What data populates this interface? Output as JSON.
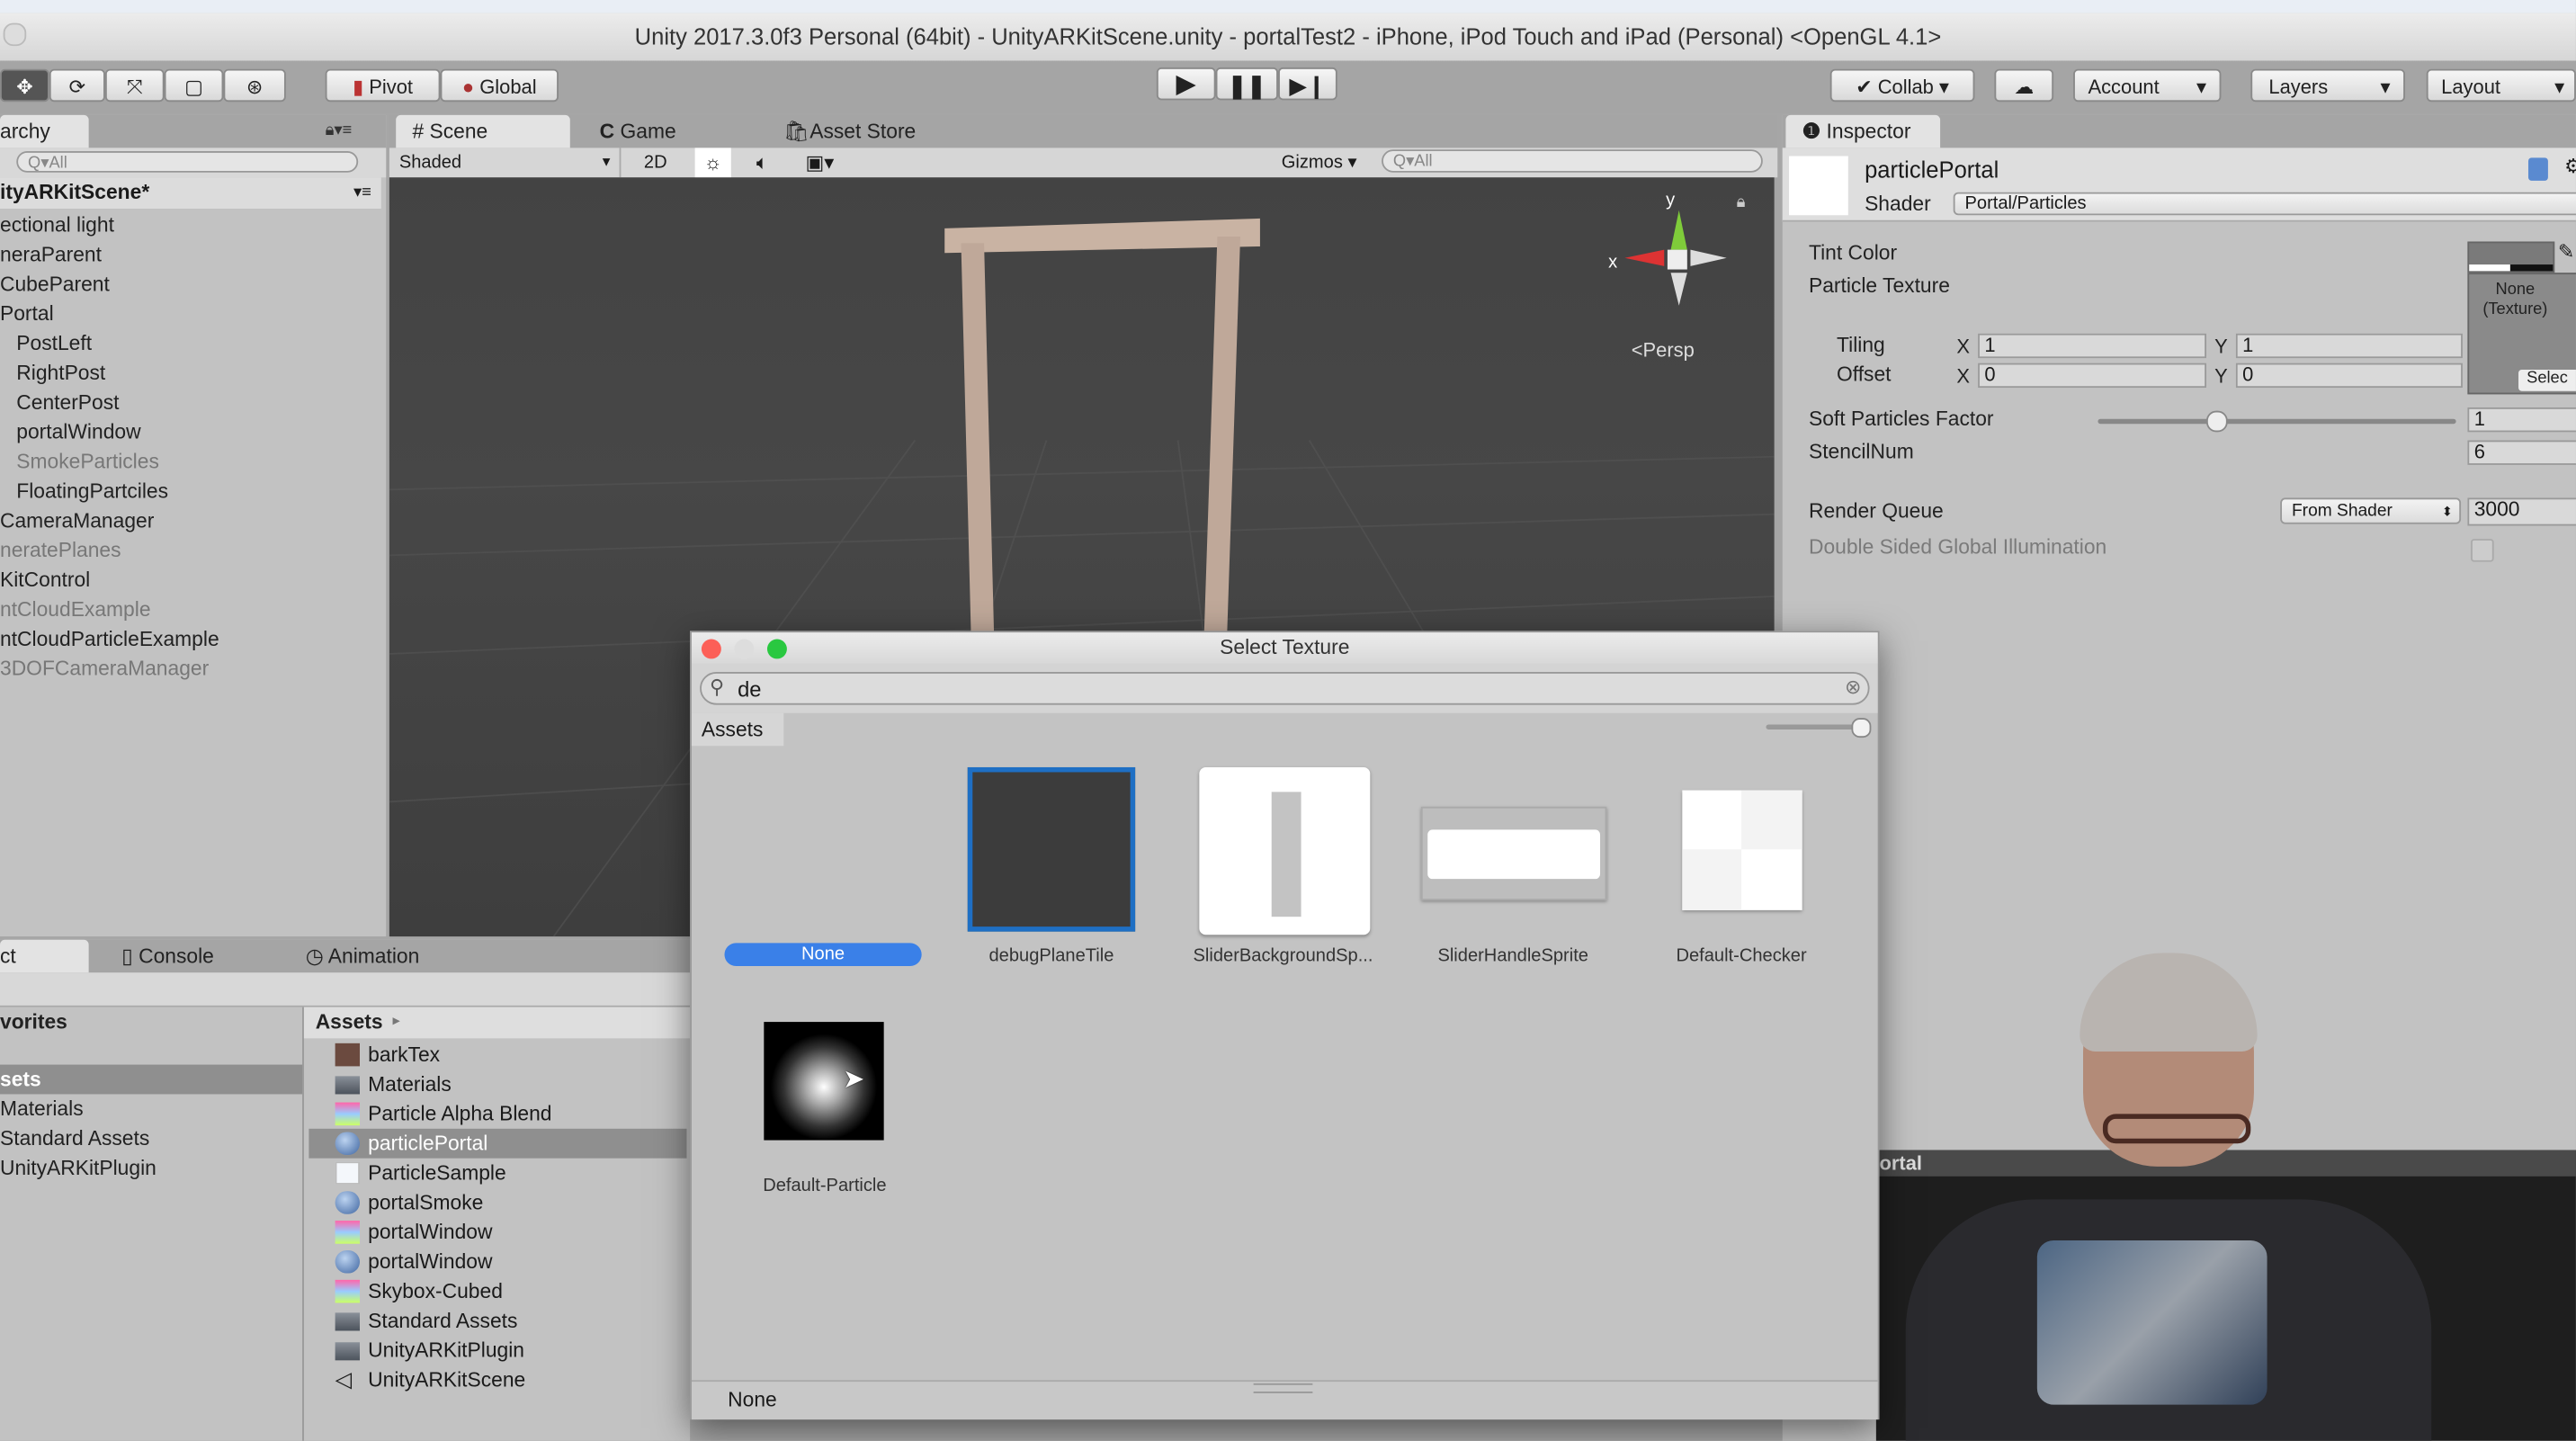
{
  "window": {
    "title": "Unity 2017.3.0f3 Personal (64bit) - UnityARKitScene.unity - portalTest2 - iPhone, iPod Touch and iPad (Personal) <OpenGL 4.1>"
  },
  "toolbar": {
    "tools": [
      "move-tool",
      "rotate-tool",
      "scale-tool",
      "rect-tool",
      "transform-tool"
    ],
    "pivot": "Pivot",
    "global": "Global",
    "collab": "Collab",
    "account": "Account",
    "layers": "Layers",
    "layout": "Layout"
  },
  "hierarchy": {
    "tab": "archy",
    "search_placeholder": "All",
    "scene": "ityARKitScene*",
    "items": [
      {
        "label": "ectional light",
        "indent": 0,
        "dim": false
      },
      {
        "label": "neraParent",
        "indent": 0,
        "dim": false
      },
      {
        "label": "CubeParent",
        "indent": 0,
        "dim": false
      },
      {
        "label": "Portal",
        "indent": 0,
        "dim": false
      },
      {
        "label": "PostLeft",
        "indent": 1,
        "dim": false
      },
      {
        "label": "RightPost",
        "indent": 1,
        "dim": false
      },
      {
        "label": "CenterPost",
        "indent": 1,
        "dim": false
      },
      {
        "label": "portalWindow",
        "indent": 1,
        "dim": false
      },
      {
        "label": "SmokeParticles",
        "indent": 1,
        "dim": true
      },
      {
        "label": "FloatingPartciles",
        "indent": 1,
        "dim": false
      },
      {
        "label": "CameraManager",
        "indent": 0,
        "dim": false
      },
      {
        "label": "neratePlanes",
        "indent": 0,
        "dim": true
      },
      {
        "label": "KitControl",
        "indent": 0,
        "dim": false
      },
      {
        "label": "ntCloudExample",
        "indent": 0,
        "dim": true
      },
      {
        "label": "ntCloudParticleExample",
        "indent": 0,
        "dim": false
      },
      {
        "label": "3DOFCameraManager",
        "indent": 0,
        "dim": true
      }
    ]
  },
  "scene": {
    "tabs": [
      "Scene",
      "Game",
      "Asset Store"
    ],
    "shading": "Shaded",
    "mode2d": "2D",
    "gizmos": "Gizmos",
    "search_placeholder": "All",
    "persp": "Persp",
    "axis_y": "y",
    "axis_x": "x"
  },
  "inspector": {
    "tab": "Inspector",
    "object": "particlePortal",
    "shader_label": "Shader",
    "shader": "Portal/Particles",
    "tint_color": "Tint Color",
    "particle_texture": "Particle Texture",
    "texture_none": "None",
    "texture_type": "(Texture)",
    "select": "Selec",
    "tiling": "Tiling",
    "offset": "Offset",
    "x": "X",
    "y": "Y",
    "tiling_x": "1",
    "tiling_y": "1",
    "offset_x": "0",
    "offset_y": "0",
    "soft_particles": "Soft Particles Factor",
    "soft_value": "1",
    "soft_slider_fraction": 0.33,
    "stencil": "StencilNum",
    "stencil_value": "6",
    "render_queue": "Render Queue",
    "render_queue_mode": "From Shader",
    "render_queue_value": "3000",
    "double_sided": "Double Sided Global Illumination",
    "double_sided_checked": false
  },
  "bottom": {
    "tabs": [
      "ct",
      "Console",
      "Animation"
    ],
    "favorites": "vorites",
    "left_items": [
      "sets",
      "Materials",
      "Standard Assets",
      "UnityARKitPlugin"
    ],
    "breadcrumb": "Assets",
    "assets": [
      {
        "label": "barkTex",
        "icon": "texture"
      },
      {
        "label": "Materials",
        "icon": "folder"
      },
      {
        "label": "Particle Alpha Blend",
        "icon": "shader"
      },
      {
        "label": "particlePortal",
        "icon": "material",
        "selected": true
      },
      {
        "label": "ParticleSample",
        "icon": "script"
      },
      {
        "label": "portalSmoke",
        "icon": "material"
      },
      {
        "label": "portalWindow",
        "icon": "shader"
      },
      {
        "label": "portalWindow",
        "icon": "material"
      },
      {
        "label": "Skybox-Cubed",
        "icon": "shader"
      },
      {
        "label": "Standard Assets",
        "icon": "folder"
      },
      {
        "label": "UnityARKitPlugin",
        "icon": "folder"
      },
      {
        "label": "UnityARKitScene",
        "icon": "unity-scene"
      }
    ]
  },
  "dialog": {
    "title": "Select Texture",
    "search": "de",
    "tab": "Assets",
    "items": [
      "None",
      "debugPlaneTile",
      "SliderBackgroundSp...",
      "SliderHandleSprite",
      "Default-Checker",
      "Default-Particle"
    ],
    "footer": "None",
    "accent": "#3a80e8"
  },
  "webcam": {
    "label": "ortal"
  }
}
